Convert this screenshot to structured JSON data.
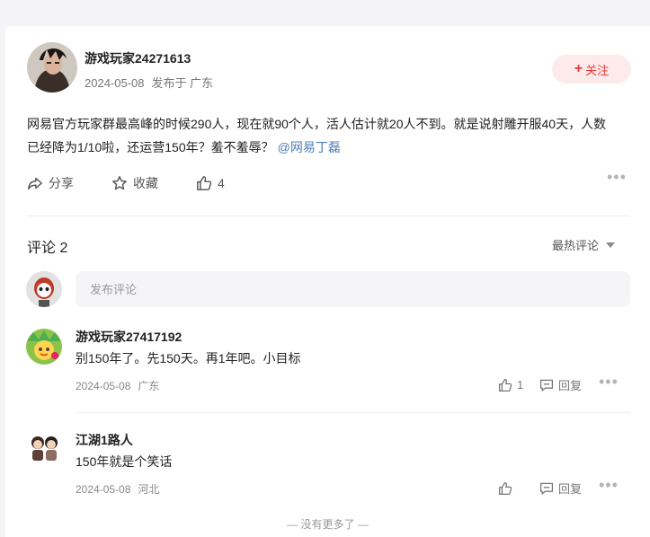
{
  "post": {
    "author": "游戏玩家24271613",
    "date": "2024-05-08",
    "location": "发布于 广东",
    "follow_label": "关注",
    "text": "网易官方玩家群最高峰的时候290人，现在就90个人，活人估计就20人不到。就是说射雕开服40天，人数已经降为1/10啦，还运营150年？羞不羞辱？",
    "mention": "@网易丁磊",
    "share_label": "分享",
    "favorite_label": "收藏",
    "like_count": "4"
  },
  "comments_section": {
    "title": "评论 2",
    "sort_label": "最热评论",
    "input_placeholder": "发布评论"
  },
  "comments": [
    {
      "author": "游戏玩家27417192",
      "text": "别150年了。先150天。再1年吧。小目标",
      "date": "2024-05-08",
      "location": "广东",
      "like_count": "1",
      "reply_label": "回复"
    },
    {
      "author": "江湖1路人",
      "text": "150年就是个笑话",
      "date": "2024-05-08",
      "location": "河北",
      "like_count": "",
      "reply_label": "回复"
    }
  ],
  "footer": {
    "no_more": "— 没有更多了 —"
  },
  "colors": {
    "accent": "#e53935",
    "follow_bg": "#fdeaea",
    "mention": "#4a7ebb"
  }
}
